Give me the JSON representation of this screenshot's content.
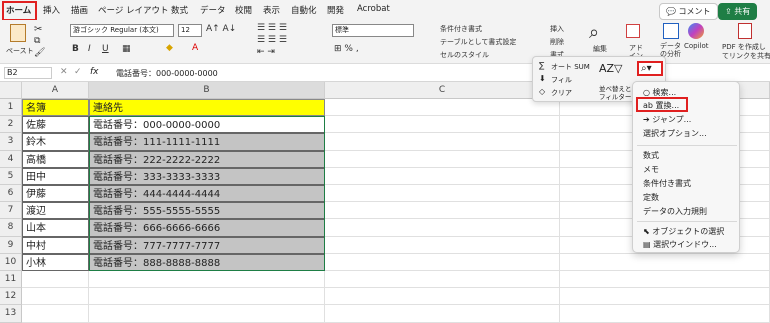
{
  "tabs": [
    "ホーム",
    "挿入",
    "描画",
    "ページ レイアウト",
    "数式",
    "データ",
    "校閲",
    "表示",
    "自動化",
    "開発",
    "Acrobat"
  ],
  "top_right": {
    "comment_label": "コメント",
    "share_label": "共有"
  },
  "ribbon": {
    "paste_label": "ペースト",
    "font_name": "游ゴシック Regular (本文)",
    "font_size": "12",
    "number_format": "標準",
    "cond_format": "条件付き書式",
    "table_format": "テーブルとして書式設定",
    "cell_style": "セルのスタイル",
    "insert": "挿入",
    "delete": "削除",
    "format": "書式",
    "edit": "編集",
    "addin": "アド イン",
    "analyze": "データ の分析",
    "copilot": "Copilot",
    "pdf_label_1": "PDF を作成し",
    "pdf_label_2": "てリンクを共有"
  },
  "formula_bar": {
    "cell_ref": "B2",
    "fx": "fx",
    "content": "電話番号：000-0000-0000"
  },
  "grid": {
    "columns": [
      "A",
      "B",
      "C"
    ],
    "rows": [
      "1",
      "2",
      "3",
      "4",
      "5",
      "6",
      "7",
      "8",
      "9",
      "10",
      "11",
      "12",
      "13"
    ],
    "header_a": "名簿",
    "header_b": "連絡先",
    "data": [
      {
        "name": "佐藤",
        "contact": "電話番号：000-0000-0000"
      },
      {
        "name": "鈴木",
        "contact": "電話番号：111-1111-1111"
      },
      {
        "name": "高橋",
        "contact": "電話番号：222-2222-2222"
      },
      {
        "name": "田中",
        "contact": "電話番号：333-3333-3333"
      },
      {
        "name": "伊藤",
        "contact": "電話番号：444-4444-4444"
      },
      {
        "name": "渡辺",
        "contact": "電話番号：555-5555-5555"
      },
      {
        "name": "山本",
        "contact": "電話番号：666-6666-6666"
      },
      {
        "name": "中村",
        "contact": "電話番号：777-7777-7777"
      },
      {
        "name": "小林",
        "contact": "電話番号：888-8888-8888"
      }
    ]
  },
  "edit_panel": {
    "autosum": "オート SUM",
    "fill": "フィル",
    "clear": "クリア",
    "sort_filter_1": "並べ替えと",
    "sort_filter_2": "フィルター"
  },
  "find_menu": {
    "search": "検索...",
    "replace": "置換...",
    "jump": "ジャンプ...",
    "select_options": "選択オプション...",
    "formulas": "数式",
    "notes": "メモ",
    "cond_format": "条件付き書式",
    "constants": "定数",
    "validation": "データの入力規則",
    "select_objects": "オブジェクトの選択",
    "select_pane": "選択ウインドウ..."
  },
  "colors": {
    "highlight": "#ffff00",
    "selection": "#c4c4c4",
    "callout": "#e02020",
    "share": "#1e7e45"
  }
}
